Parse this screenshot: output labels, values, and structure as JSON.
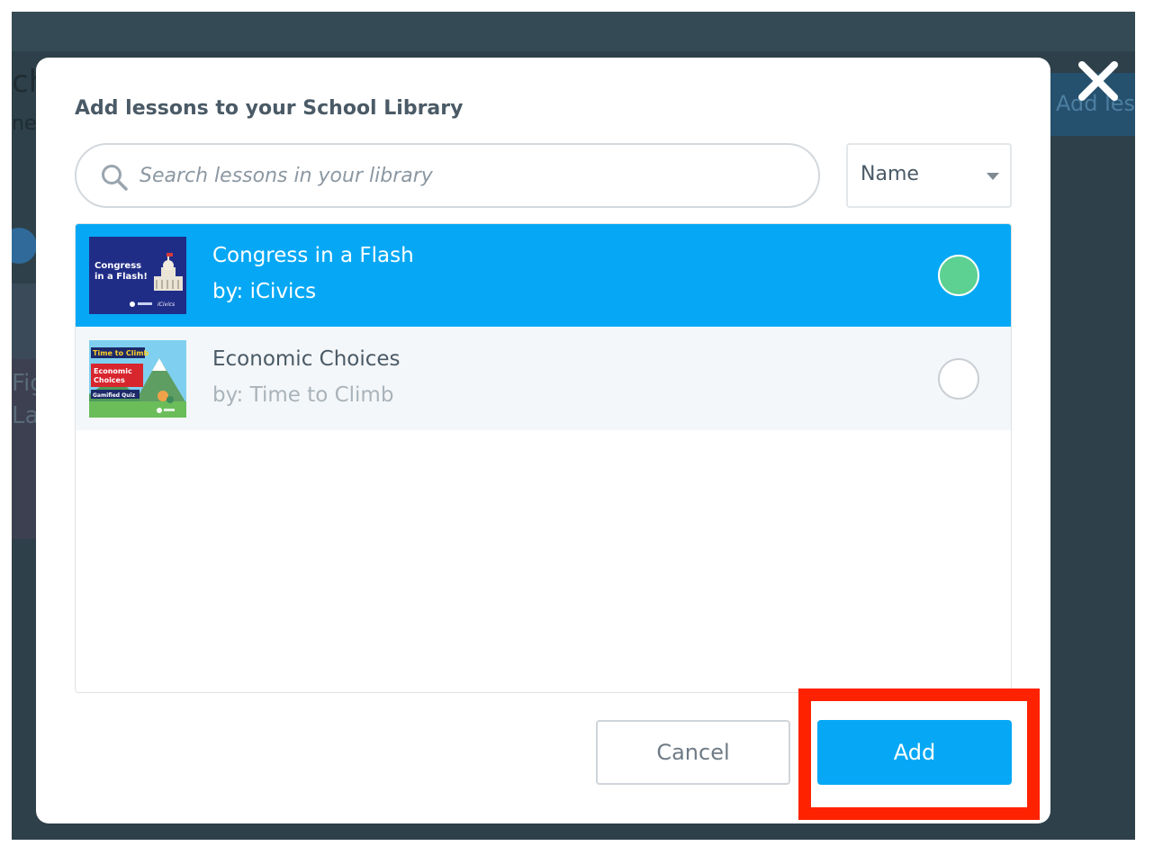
{
  "background": {
    "text_fragment_1": "ch",
    "text_fragment_2": "ne'",
    "text_fragment_3": "Fig",
    "text_fragment_4": "La",
    "add_button_fragment": "Add les"
  },
  "modal": {
    "title": "Add lessons to your School Library",
    "close_icon": "close-icon",
    "search": {
      "placeholder": "Search lessons in your library",
      "value": "",
      "icon": "search-icon"
    },
    "sort": {
      "selected": "Name",
      "icon": "chevron-down-icon"
    },
    "lessons": [
      {
        "title": "Congress in a Flash",
        "author": "by: iCivics",
        "selected": true,
        "thumbnail_text": "Congress in a Flash!",
        "thumbnail_brand": "iCivics"
      },
      {
        "title": "Economic Choices",
        "author": "by: Time to Climb",
        "selected": false,
        "thumbnail_text": "Economic Choices",
        "thumbnail_banner": "Time to Climb",
        "thumbnail_caption": "Gamified Quiz"
      }
    ],
    "buttons": {
      "cancel": "Cancel",
      "add": "Add"
    }
  },
  "colors": {
    "accent": "#06a8f5",
    "selected_radio": "#5cd192",
    "highlight": "#ff2200",
    "backdrop": "#2e4049"
  }
}
